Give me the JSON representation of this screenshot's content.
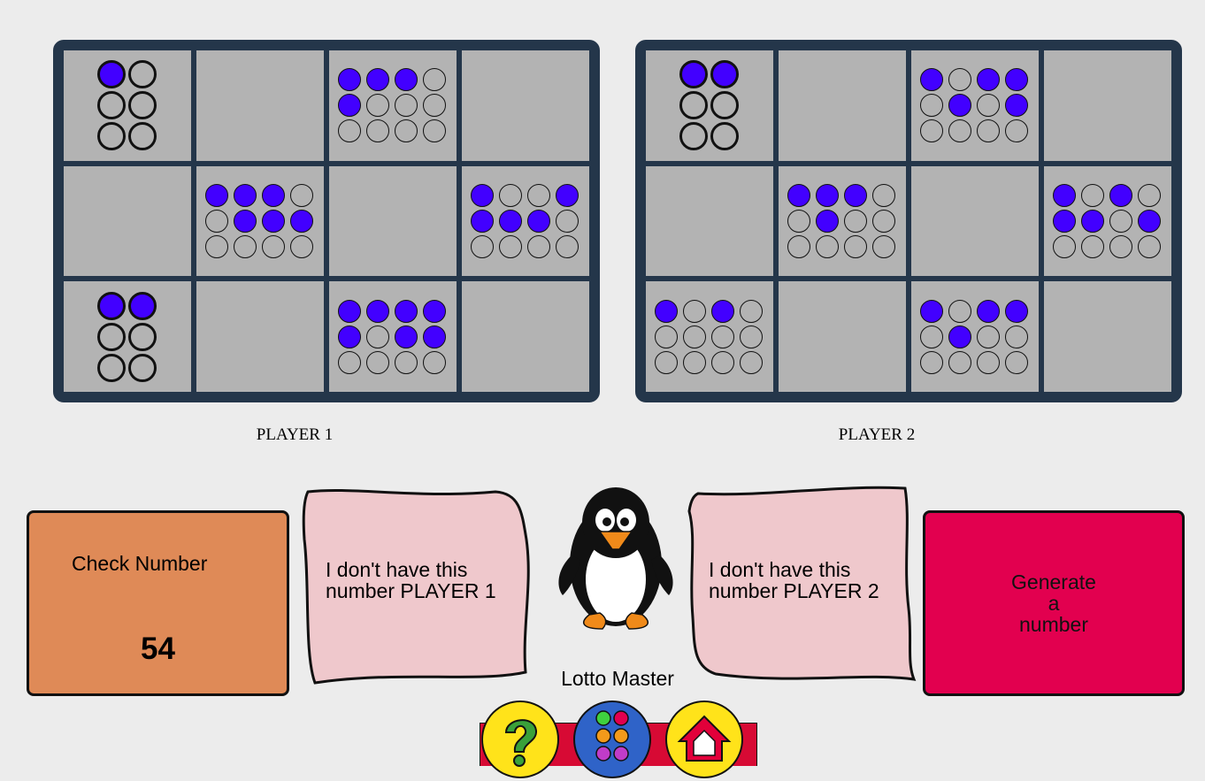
{
  "players": [
    {
      "label": "PLAYER 1",
      "cells": [
        {
          "pattern": [
            1,
            0,
            0,
            0,
            0,
            0
          ],
          "cols": 2
        },
        null,
        {
          "pattern": [
            1,
            1,
            1,
            0,
            1,
            0,
            0,
            0,
            0,
            0,
            0,
            0
          ],
          "cols": 4
        },
        null,
        null,
        {
          "pattern": [
            1,
            1,
            1,
            0,
            0,
            1,
            1,
            1,
            0,
            0,
            0,
            0
          ],
          "cols": 4
        },
        null,
        {
          "pattern": [
            1,
            0,
            0,
            1,
            1,
            1,
            1,
            0,
            0,
            0,
            0,
            0
          ],
          "cols": 4
        },
        {
          "pattern": [
            1,
            1,
            0,
            0,
            0,
            0
          ],
          "cols": 2
        },
        null,
        {
          "pattern": [
            1,
            1,
            1,
            1,
            1,
            0,
            1,
            1,
            0,
            0,
            0,
            0
          ],
          "cols": 4
        },
        null
      ]
    },
    {
      "label": "PLAYER 2",
      "cells": [
        {
          "pattern": [
            1,
            1,
            0,
            0,
            0,
            0
          ],
          "cols": 2
        },
        null,
        {
          "pattern": [
            1,
            0,
            1,
            1,
            0,
            1,
            0,
            1,
            0,
            0,
            0,
            0
          ],
          "cols": 4
        },
        null,
        null,
        {
          "pattern": [
            1,
            1,
            1,
            0,
            0,
            1,
            0,
            0,
            0,
            0,
            0,
            0
          ],
          "cols": 4
        },
        null,
        {
          "pattern": [
            1,
            0,
            1,
            0,
            1,
            1,
            0,
            1,
            0,
            0,
            0,
            0
          ],
          "cols": 4
        },
        {
          "pattern": [
            1,
            0,
            1,
            0,
            0,
            0,
            0,
            0,
            0,
            0,
            0,
            0
          ],
          "cols": 4
        },
        null,
        {
          "pattern": [
            1,
            0,
            1,
            1,
            0,
            1,
            0,
            0,
            0,
            0,
            0,
            0
          ],
          "cols": 4
        },
        null
      ]
    }
  ],
  "check": {
    "title": "Check Number",
    "value": "54"
  },
  "no_number_p1": "I don't have this\nnumber PLAYER 1",
  "no_number_p2": "I don't have this\nnumber PLAYER 2",
  "generate": "Generate\na\nnumber",
  "mascot_label": "Lotto Master",
  "colors": {
    "dot_on": "#4200ff",
    "board_frame": "#24364a",
    "cell": "#b3b3b3",
    "check_bg": "#df8a57",
    "generate_bg": "#e2004f",
    "scroll_bg": "#efc8cc"
  },
  "icons": {
    "penguin": "penguin-mascot-icon",
    "help": "question-mark-icon",
    "menu": "colored-dots-icon",
    "home": "home-icon"
  }
}
